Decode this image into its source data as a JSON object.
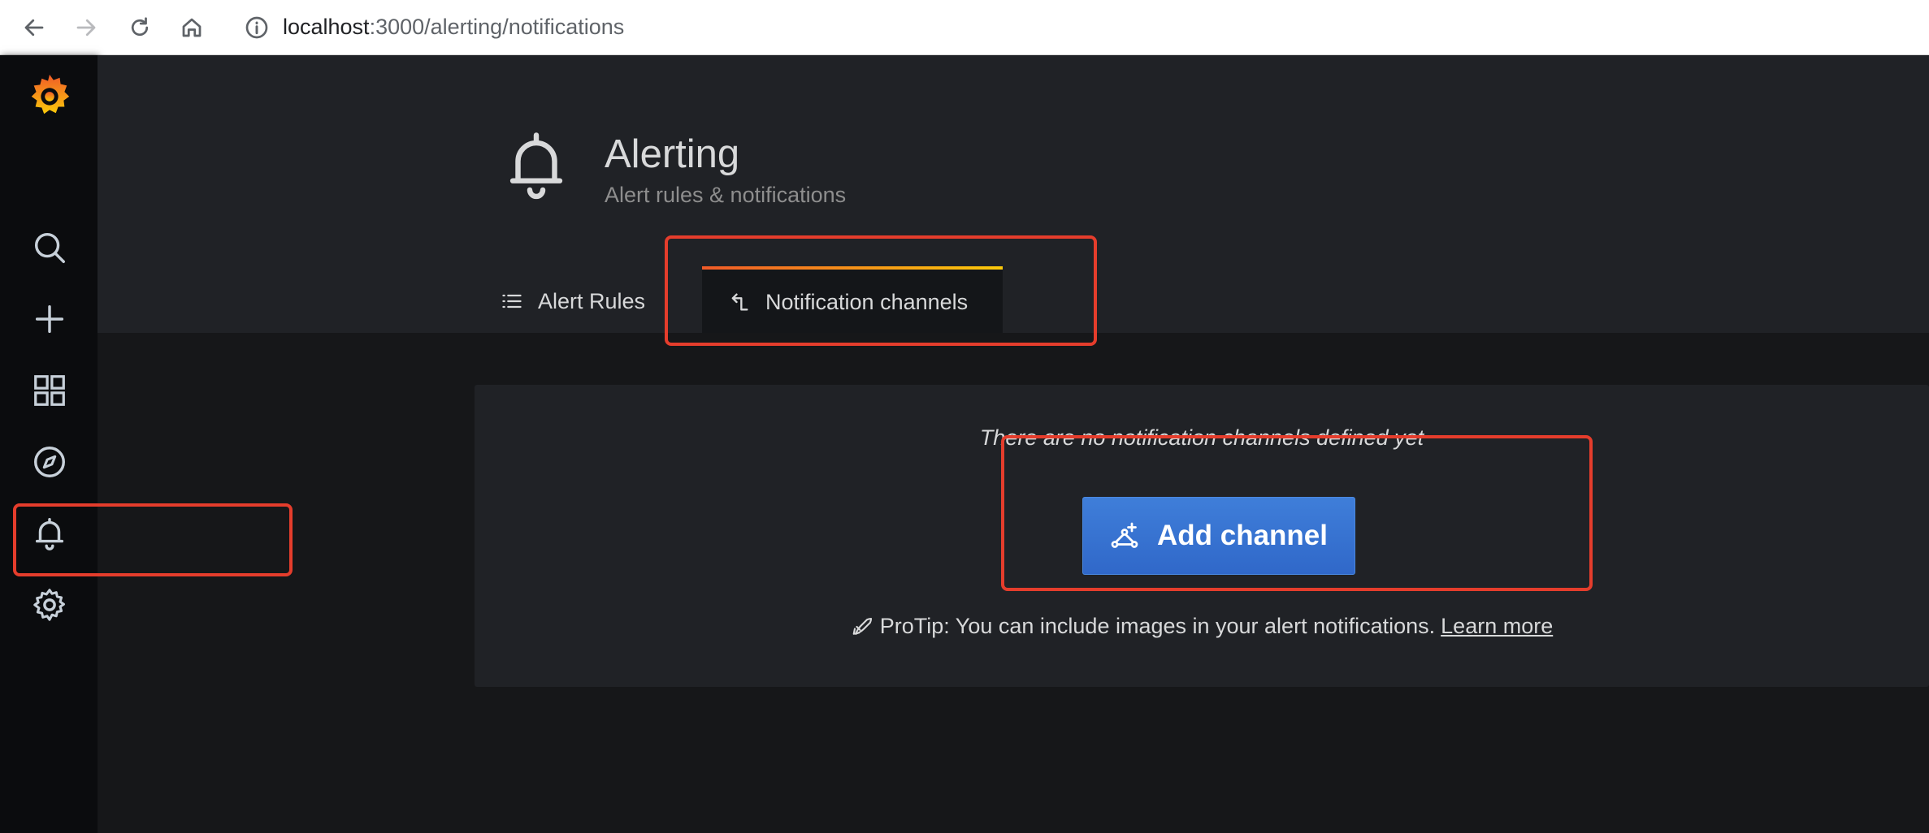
{
  "browser": {
    "url_host": "localhost",
    "url_path": ":3000/alerting/notifications",
    "icons": [
      "back-icon",
      "forward-icon",
      "reload-icon",
      "home-icon",
      "info-icon"
    ]
  },
  "sidebar": {
    "logo": "grafana-logo",
    "items": [
      {
        "icon": "search-icon"
      },
      {
        "icon": "plus-icon"
      },
      {
        "icon": "dashboards-icon"
      },
      {
        "icon": "compass-icon"
      },
      {
        "icon": "bell-icon"
      },
      {
        "icon": "gear-icon"
      }
    ]
  },
  "header": {
    "title": "Alerting",
    "subtitle": "Alert rules & notifications"
  },
  "tabs": [
    {
      "label": "Alert Rules",
      "icon": "list-icon",
      "active": false
    },
    {
      "label": "Notification channels",
      "icon": "share-icon",
      "active": true
    }
  ],
  "empty_state": {
    "message": "There are no notification channels defined yet",
    "button_label": "Add channel",
    "protip": "ProTip: You can include images in your alert notifications.",
    "learn_more": "Learn more"
  },
  "colors": {
    "accent_blue": "#3274d9",
    "annotation_red": "#e53d2c",
    "tab_gradient_start": "#f05a28",
    "tab_gradient_end": "#fbca0a"
  }
}
